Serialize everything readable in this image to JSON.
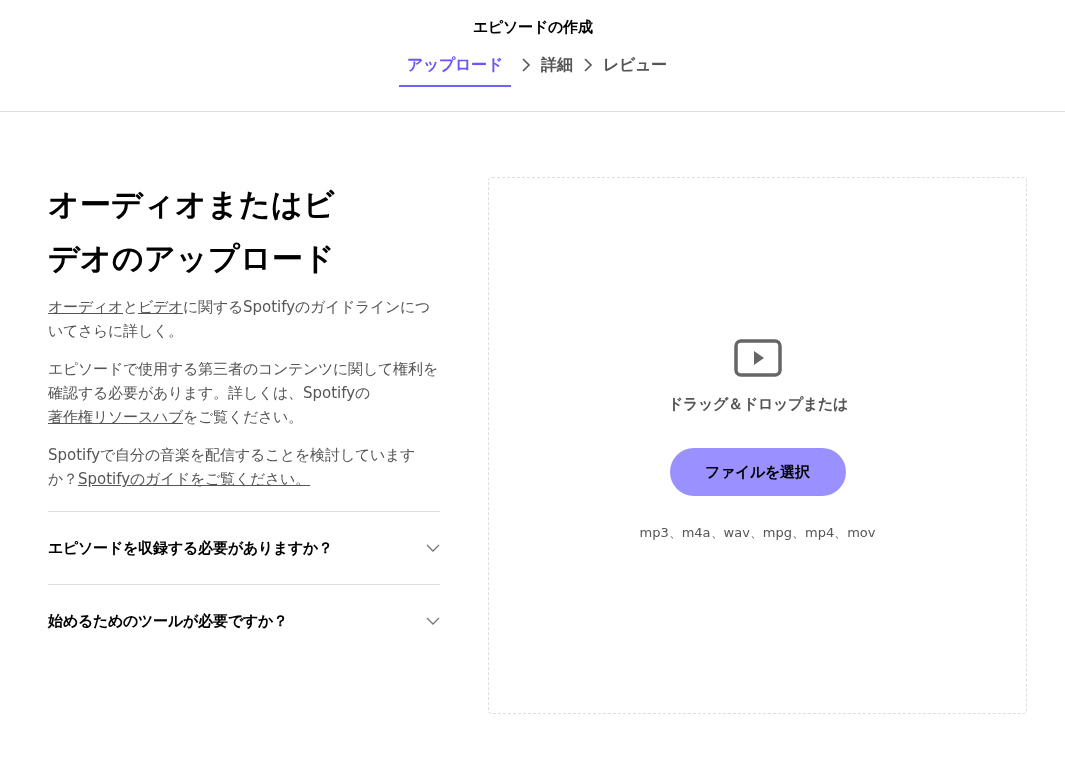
{
  "header": {
    "title": "エピソードの作成",
    "steps": [
      {
        "label": "アップロード",
        "selected": true
      },
      {
        "label": "詳細",
        "selected": false
      },
      {
        "label": "レビュー",
        "selected": false
      }
    ]
  },
  "intro": {
    "heading": "オーディオまたはビデオのアップロード",
    "paragraphs": [
      {
        "segments": [
          {
            "text": "オーディオ",
            "link": true
          },
          {
            "text": "と",
            "link": false
          },
          {
            "text": "ビデオ",
            "link": true
          },
          {
            "text": "に関するSpotifyのガイドラインについてさらに詳しく。",
            "link": false
          }
        ]
      },
      {
        "segments": [
          {
            "text": "エピソードで使用する第三者のコンテンツに関して権利を確認する必要があります。詳しくは、Spotifyの",
            "link": false
          },
          {
            "text": "著作権リソースハブ",
            "link": true
          },
          {
            "text": "をご覧ください。",
            "link": false
          }
        ]
      },
      {
        "segments": [
          {
            "text": "Spotifyで自分の音楽を配信することを検討していますか？",
            "link": false
          },
          {
            "text": "Spotifyのガイドをご覧ください。",
            "link": true
          }
        ]
      }
    ],
    "faq": [
      {
        "question": "エピソードを収録する必要がありますか？",
        "expanded": false
      },
      {
        "question": "始めるためのツールが必要ですか？",
        "expanded": false
      }
    ]
  },
  "dropzone": {
    "prompt": "ドラッグ＆ドロップまたは",
    "button": "ファイルを選択",
    "formats": "mp3、m4a、wav、mpg、mp4、mov"
  }
}
